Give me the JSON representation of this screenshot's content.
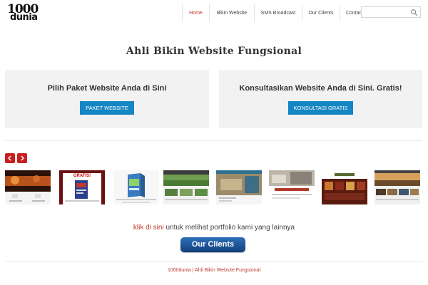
{
  "header": {
    "logo_number": "1000",
    "logo_word": "dunia",
    "nav": [
      {
        "label": "Home",
        "active": true
      },
      {
        "label": "Bikin Website",
        "active": false
      },
      {
        "label": "SMS Broadcast",
        "active": false
      },
      {
        "label": "Our Clients",
        "active": false
      },
      {
        "label": "Contact",
        "active": false
      }
    ],
    "search_placeholder": "",
    "search_icon": "search-icon"
  },
  "main": {
    "title": "Ahli Bikin Website Fungsional",
    "cta_left": {
      "heading": "Pilih Paket Website Anda di Sini",
      "button": "PAKET WEBSITE"
    },
    "cta_right": {
      "heading": "Konsultasikan Website Anda di Sini. Gratis!",
      "button": "KONSULTASI GRATIS"
    }
  },
  "carousel": {
    "prev_icon": "chevron-left-icon",
    "next_icon": "chevron-right-icon",
    "thumbnail_count": 9,
    "thumb_caption": "GRATIS!"
  },
  "portfolio": {
    "link_text": "klik di sini",
    "rest_text": " untuk melihat portfolio kami yang lainnya",
    "button": "Our Clients"
  },
  "footer": {
    "text": "1000dunia | Ahli Bikin Website Fungsional"
  },
  "colors": {
    "accent_red": "#c0392b",
    "button_blue": "#1586c4",
    "carousel_red": "#c8201f",
    "clients_blue": "#1f5499"
  }
}
